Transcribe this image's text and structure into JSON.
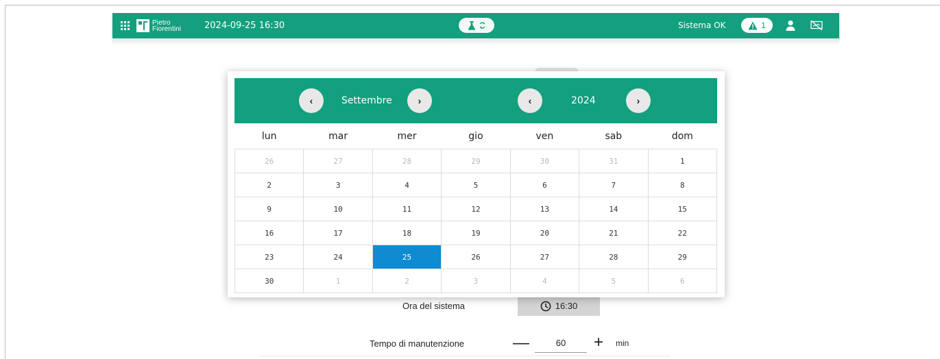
{
  "colors": {
    "accent": "#12a07e",
    "selected": "#0e8bd1"
  },
  "header": {
    "brand_line1": "Pietro",
    "brand_line2": "Fiorentini",
    "datetime": "2024-09-25 16:30",
    "status": "Sistema OK",
    "alarm_count": "1",
    "icons": [
      "apps-grid-icon",
      "flask-icon",
      "refresh-icon",
      "warning-icon",
      "user-icon",
      "network-disconnected-icon"
    ]
  },
  "calendar": {
    "month": "Settembre",
    "year": "2024",
    "weekdays": [
      "lun",
      "mar",
      "mer",
      "gio",
      "ven",
      "sab",
      "dom"
    ],
    "weeks": [
      [
        "26",
        "27",
        "28",
        "29",
        "30",
        "31",
        "1"
      ],
      [
        "2",
        "3",
        "4",
        "5",
        "6",
        "7",
        "8"
      ],
      [
        "9",
        "10",
        "11",
        "12",
        "13",
        "14",
        "15"
      ],
      [
        "16",
        "17",
        "18",
        "19",
        "20",
        "21",
        "22"
      ],
      [
        "23",
        "24",
        "25",
        "26",
        "27",
        "28",
        "29"
      ],
      [
        "30",
        "1",
        "2",
        "3",
        "4",
        "5",
        "6"
      ]
    ],
    "selected_day": "25"
  },
  "form": {
    "time_label": "Ora del sistema",
    "time_value": "16:30",
    "maintenance_label": "Tempo di manutenzione",
    "maintenance_value": "60",
    "maintenance_unit": "min",
    "minus": "—",
    "plus": "+"
  }
}
